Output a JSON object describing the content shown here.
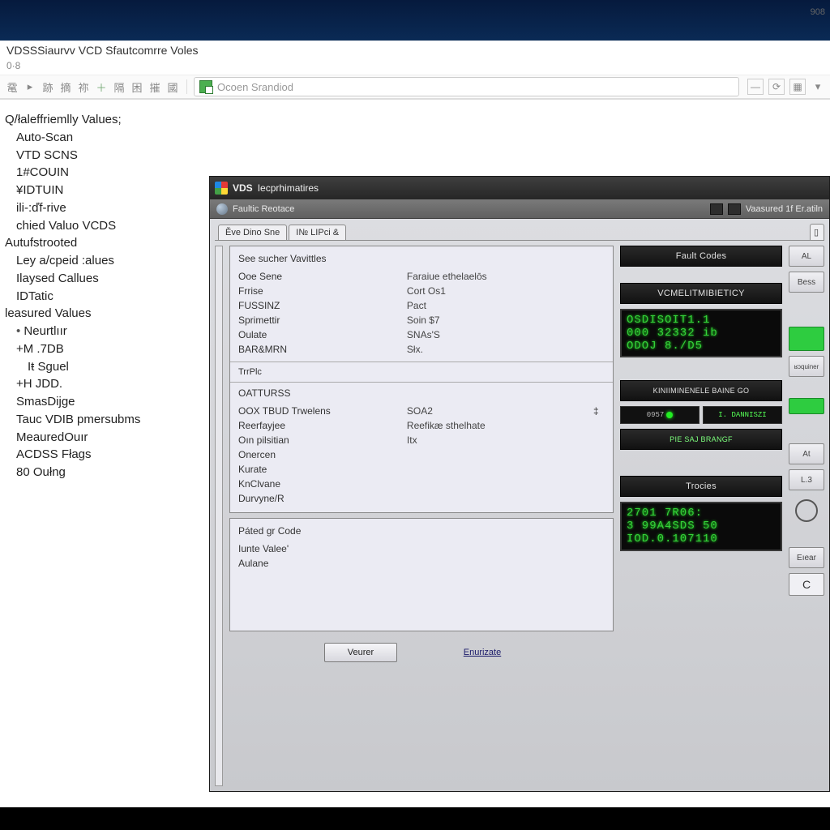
{
  "explorer": {
    "title": "VDSSSiaurvv VCD Sfautcomrre Voles",
    "sub": "0·8",
    "address": "Ocoen Srandiod",
    "corner": "908"
  },
  "sidebar": {
    "items": [
      {
        "label": "Q/łaleffriemlly Values;",
        "lvl": 0
      },
      {
        "label": "Auto-Scan",
        "lvl": 1
      },
      {
        "label": "VTD SCNS",
        "lvl": 1
      },
      {
        "label": "1#COUIN",
        "lvl": 1
      },
      {
        "label": "¥IDTUIN",
        "lvl": 1
      },
      {
        "label": "ili-:ďf-rive",
        "lvl": 1
      },
      {
        "label": "chied Valuo VCDS",
        "lvl": 1
      },
      {
        "label": "Autufstrooted",
        "lvl": 0
      },
      {
        "label": "Ley a/cpeid :alues",
        "lvl": 1
      },
      {
        "label": "Ilaysed Callues",
        "lvl": 1
      },
      {
        "label": "IDTatic",
        "lvl": 1
      },
      {
        "label": "leasured Values",
        "lvl": 0
      },
      {
        "label": "Neurtlıır",
        "lvl": 1,
        "bullet": true
      },
      {
        "label": "+M .7DB",
        "lvl": 1
      },
      {
        "label": "Iŧ Sguel",
        "lvl": 2
      },
      {
        "label": "+H JDD.",
        "lvl": 1
      },
      {
        "label": "SmasDijge",
        "lvl": 1
      },
      {
        "label": "Tauc VDIB pmersubms",
        "lvl": 1
      },
      {
        "label": "MeauredOuır",
        "lvl": 1
      },
      {
        "label": "ACDSS Fłags",
        "lvl": 1
      },
      {
        "label": "80 Oułng",
        "lvl": 1
      }
    ]
  },
  "window": {
    "title_prefix": "VDS",
    "title_rest": "Iecprhimatires",
    "subbar_left": "Faultic Reotace",
    "subbar_right": "Vaasured 1f Er.atiln",
    "tabs": [
      "Ěve Dino Sne",
      "I№ LIPci &"
    ],
    "panel1": {
      "header": "See sucher Vavittles",
      "rows": [
        {
          "k": "Ooe Sene",
          "v": "Faraiue ethelaelōs"
        },
        {
          "k": "Frrise",
          "v": "Cort Os1"
        },
        {
          "k": "FUSSINZ",
          "v": "Pact"
        },
        {
          "k": "Sprimettir",
          "v": "Soin $7"
        },
        {
          "k": "Oulate",
          "v": "SNAs'S"
        },
        {
          "k": "BAR&MRN",
          "v": "Słx."
        }
      ],
      "mid_label": "TrrPlc",
      "sect2_header": "OATTURSS",
      "rows2": [
        {
          "k": "OOX TBUD Trwelens",
          "v": "SOA2",
          "marker": "‡"
        },
        {
          "k": "Reerfayjee",
          "v": "Reefikæ sthelhate"
        },
        {
          "k": "Oın pilsitian",
          "v": "Itx"
        },
        {
          "k": "Onercen",
          "v": ""
        },
        {
          "k": "Kurate",
          "v": ""
        },
        {
          "k": "KnClvane",
          "v": ""
        },
        {
          "k": "Durvyne/R",
          "v": ""
        }
      ]
    },
    "panel2": {
      "header": "Páted gr Code",
      "rows": [
        {
          "k": "Iunte Valee'",
          "v": ""
        },
        {
          "k": "Aulane",
          "v": ""
        }
      ]
    },
    "buttons": {
      "verify": "Veurer",
      "execute": "Enurizate"
    },
    "right": {
      "fault_codes": "Fault Codes",
      "battery": "VCMELITMIBIETICY",
      "lcd1": [
        "OSDISOIT1.1",
        "000 32332 ib",
        "ODOJ 8./D5"
      ],
      "engine": "KINIIMINENELE BAINE GO",
      "status": {
        "left": "0957",
        "right": "I. DANNISZI"
      },
      "spark": "PIE SAJ BRANGF",
      "troues": "Trocies",
      "lcd2": [
        "2701 7R06:",
        "3  99A4SDS 50",
        "IOD.0.107110"
      ]
    },
    "far": {
      "al": "AL",
      "bt": "Bess",
      "rq": "ʁɔquiner",
      "at": "At",
      "la": "L.3",
      "ex": "Eıear",
      "c": "C"
    }
  }
}
